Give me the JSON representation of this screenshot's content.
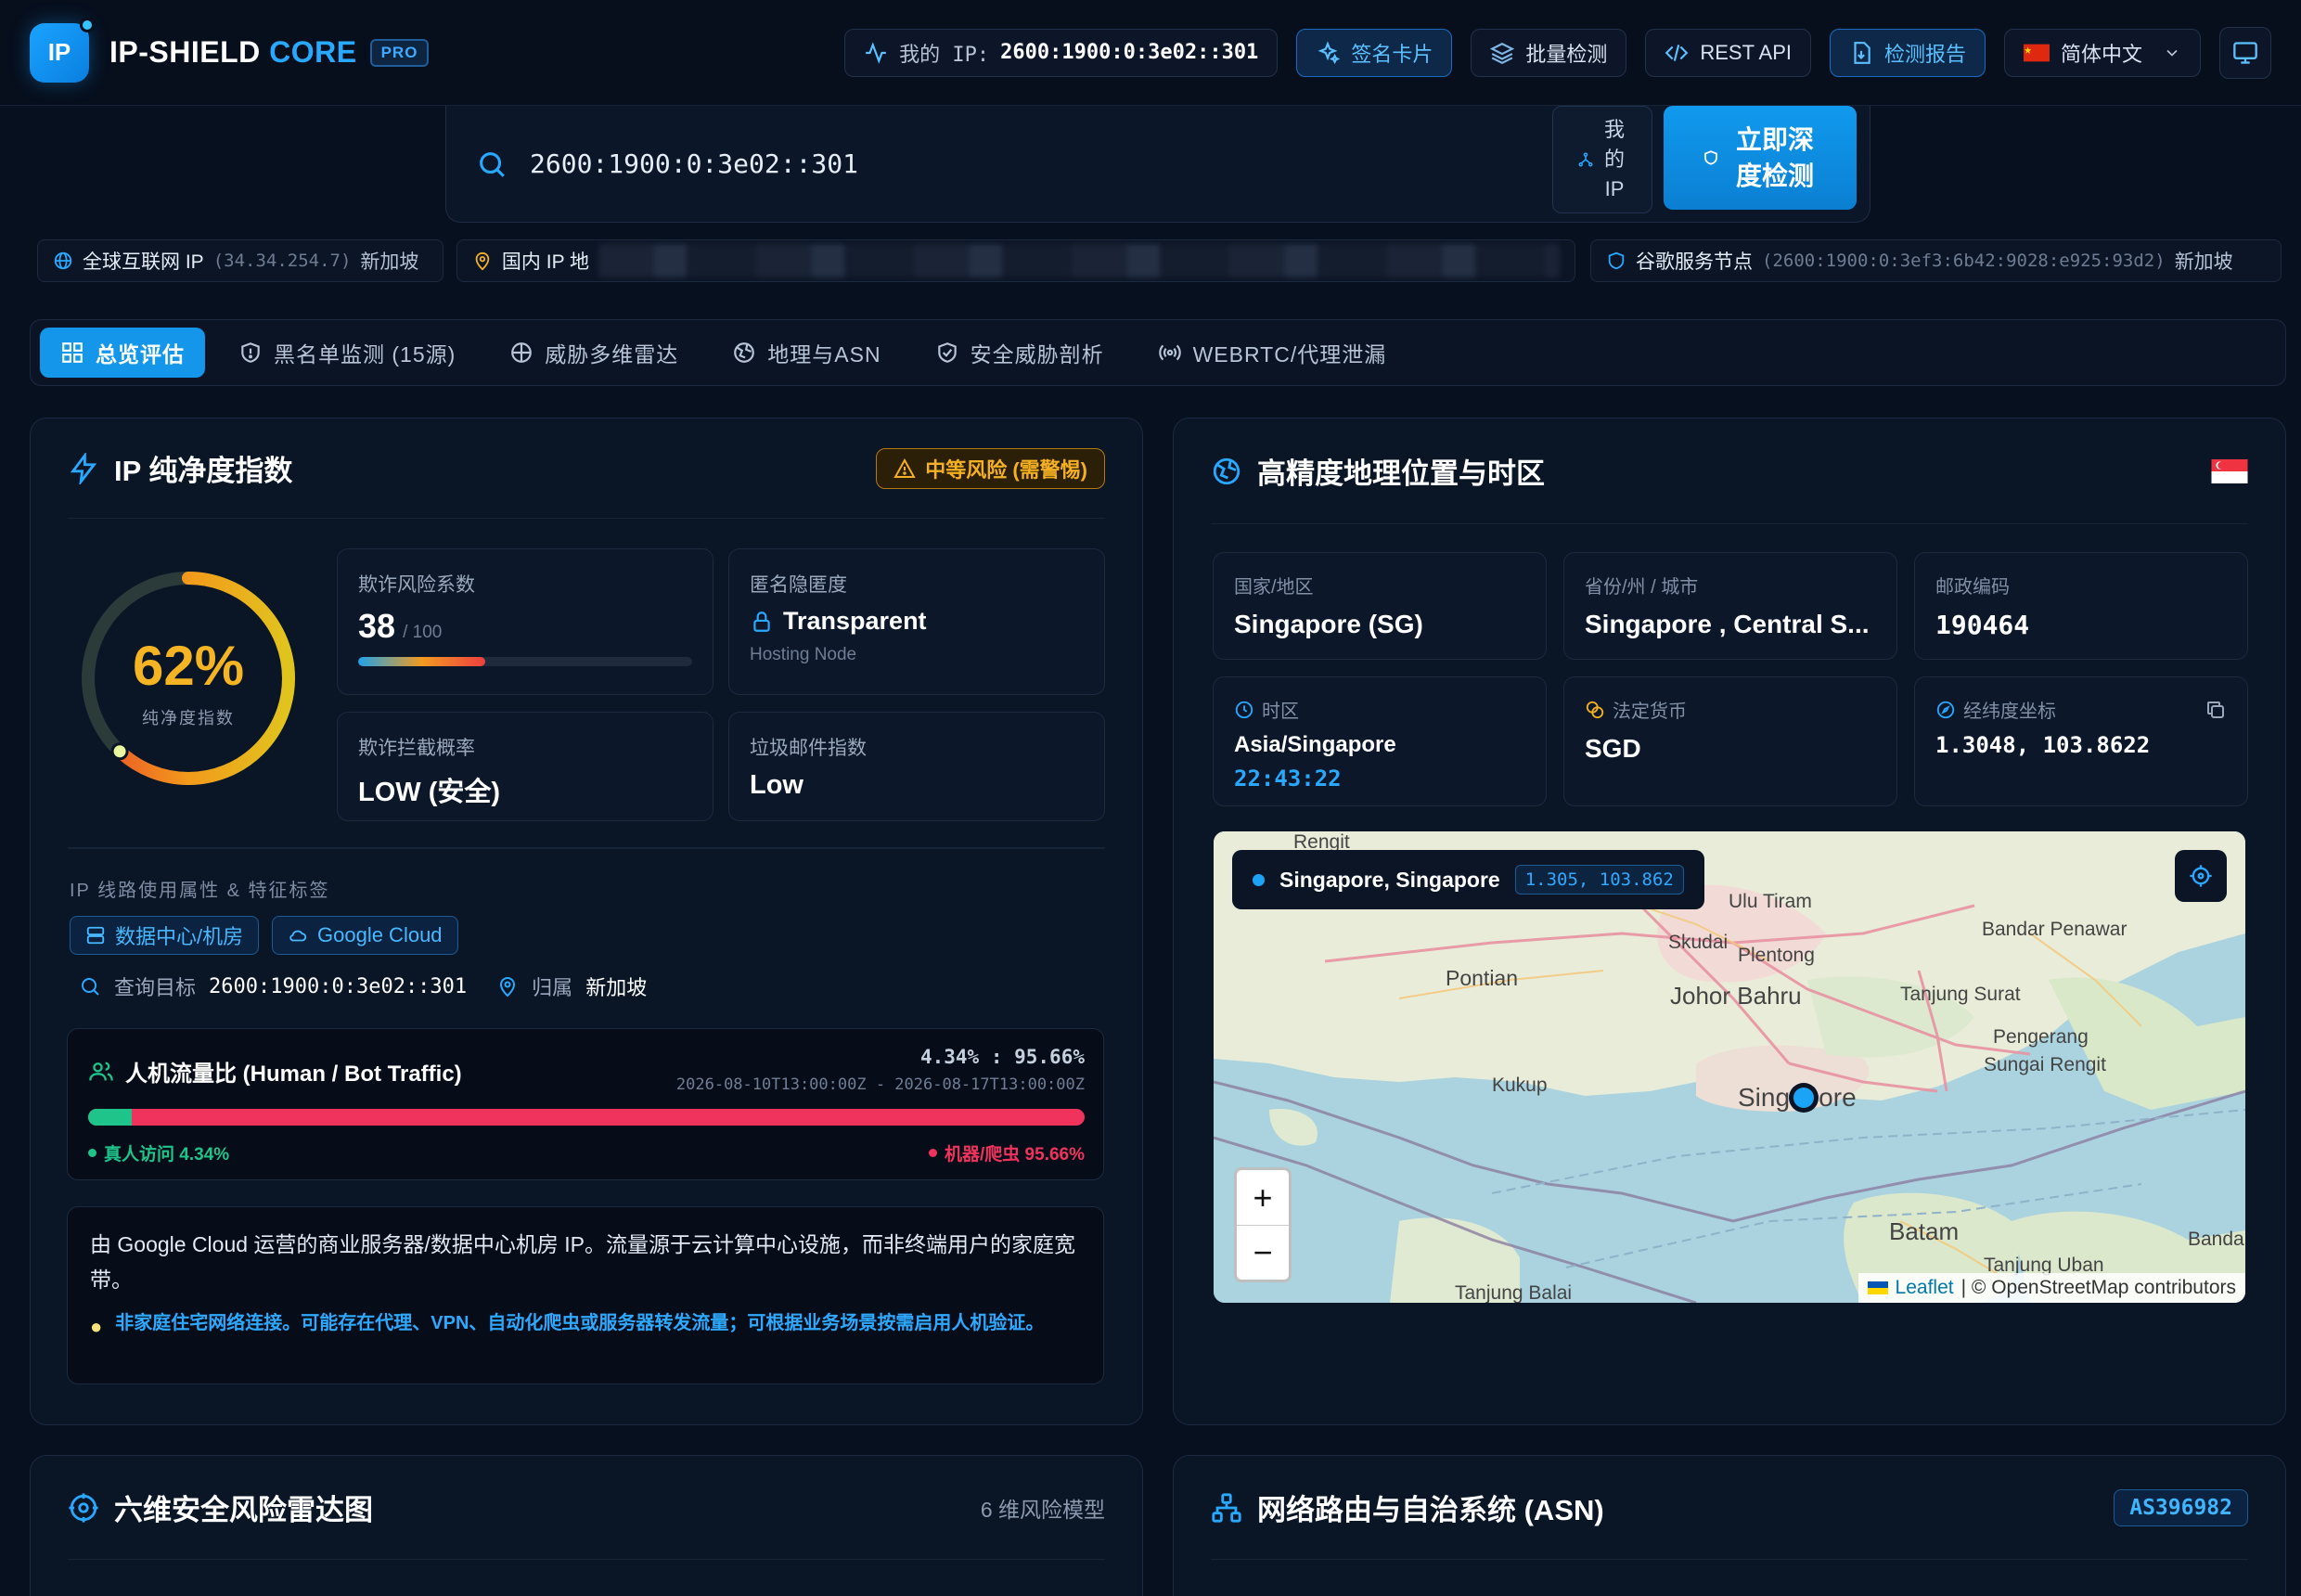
{
  "header": {
    "logo_text": "IP",
    "brand_main": "IP-SHIELD",
    "brand_accent": "CORE",
    "pro_label": "PRO",
    "my_ip_label": "我的 IP:",
    "my_ip_value": "2600:1900:0:3e02::301",
    "sign_card_label": "签名卡片",
    "batch_label": "批量检测",
    "api_label": "REST API",
    "report_label": "检测报告",
    "language_label": "简体中文"
  },
  "search": {
    "query": "2600:1900:0:3e02::301",
    "my_ip_button": "我的IP",
    "deep_check_button": "立即深度检测"
  },
  "strip": {
    "global_label": "全球互联网 IP",
    "global_ip": "(34.34.254.7)",
    "global_loc": "新加坡",
    "domestic_label": "国内 IP 地",
    "google_label": "谷歌服务节点",
    "google_ip": "(2600:1900:0:3ef3:6b42:9028:e925:93d2)",
    "google_loc": "新加坡"
  },
  "tabs": [
    {
      "label": "总览评估",
      "icon": "grid-icon"
    },
    {
      "label": "黑名单监测 (15源)",
      "icon": "shield-alert-icon"
    },
    {
      "label": "威胁多维雷达",
      "icon": "radar-icon"
    },
    {
      "label": "地理与ASN",
      "icon": "globe-icon"
    },
    {
      "label": "安全威胁剖析",
      "icon": "shield-check-icon"
    },
    {
      "label": "WEBRTC/代理泄漏",
      "icon": "broadcast-icon"
    }
  ],
  "purity": {
    "title": "IP 纯净度指数",
    "risk_badge": "中等风险 (需警惕)",
    "score_text": "62%",
    "score_value": 62,
    "score_label": "纯净度指数",
    "fraud_label": "欺诈风险系数",
    "fraud_value": "38",
    "fraud_max": "/ 100",
    "fraud_fraction": 0.38,
    "anon_label": "匿名隐匿度",
    "anon_value": "Transparent",
    "anon_sub": "Hosting Node",
    "block_label": "欺诈拦截概率",
    "block_value": "LOW (安全)",
    "spam_label": "垃圾邮件指数",
    "spam_value": "Low",
    "tags_label": "IP 线路使用属性 & 特征标签",
    "tag1": "数据中心/机房",
    "tag2": "Google Cloud",
    "query_label": "查询目标",
    "query_value": "2600:1900:0:3e02::301",
    "owner_label": "归属",
    "owner_value": "新加坡"
  },
  "traffic": {
    "title": "人机流量比 (Human / Bot Traffic)",
    "ratio": "4.34% : 95.66%",
    "range": "2026-08-10T13:00:00Z - 2026-08-17T13:00:00Z",
    "human_label": "真人访问 4.34%",
    "bot_label": "机器/爬虫 95.66%",
    "human_fraction": 0.0434
  },
  "description": {
    "main": "由 Google Cloud 运营的商业服务器/数据中心机房 IP。流量源于云计算中心设施，而非终端用户的家庭宽带。",
    "tip": "非家庭住宅网络连接。可能存在代理、VPN、自动化爬虫或服务器转发流量；可根据业务场景按需启用人机验证。"
  },
  "geo": {
    "title": "高精度地理位置与时区",
    "country_label": "国家/地区",
    "country_value": "Singapore (SG)",
    "region_label": "省份/州 / 城市",
    "region_value": "Singapore , Central S...",
    "postal_label": "邮政编码",
    "postal_value": "190464",
    "tz_label": "时区",
    "tz_value": "Asia/Singapore",
    "tz_time": "22:43:22",
    "currency_label": "法定货币",
    "currency_value": "SGD",
    "coord_label": "经纬度坐标",
    "coord_value": "1.3048, 103.8622",
    "map_popup_place": "Singapore, Singapore",
    "map_popup_coord": "1.305, 103.862",
    "map_attribution_leaflet": "Leaflet",
    "map_attribution_rest": "| © OpenStreetMap contributors",
    "map_labels": {
      "pontian": "Pontian",
      "skudai": "Skudai",
      "plentong": "Plentong",
      "johor": "Johor Bahru",
      "ulu": "Ulu Tiram",
      "bandar": "Bandar Penawar",
      "tanjung_surat": "Tanjung Surat",
      "pengerang": "Pengerang",
      "sungai": "Sungai Rengit",
      "kukup": "Kukup",
      "singapore": "Singapore",
      "batam": "Batam",
      "tanjung_uban": "Tanjung Uban",
      "tanjung_balai": "Tanjung Balai",
      "bandar_bent": "Bandar Bent",
      "rengit": "Rengit"
    }
  },
  "radar": {
    "title": "六维安全风险雷达图",
    "model_label": "6 维风险模型"
  },
  "asn": {
    "title": "网络路由与自治系统 (ASN)",
    "badge": "AS396982"
  },
  "colors": {
    "accent": "#1497ea",
    "warning": "#f4b022",
    "human": "#1fc48a",
    "bot": "#f0335c"
  }
}
